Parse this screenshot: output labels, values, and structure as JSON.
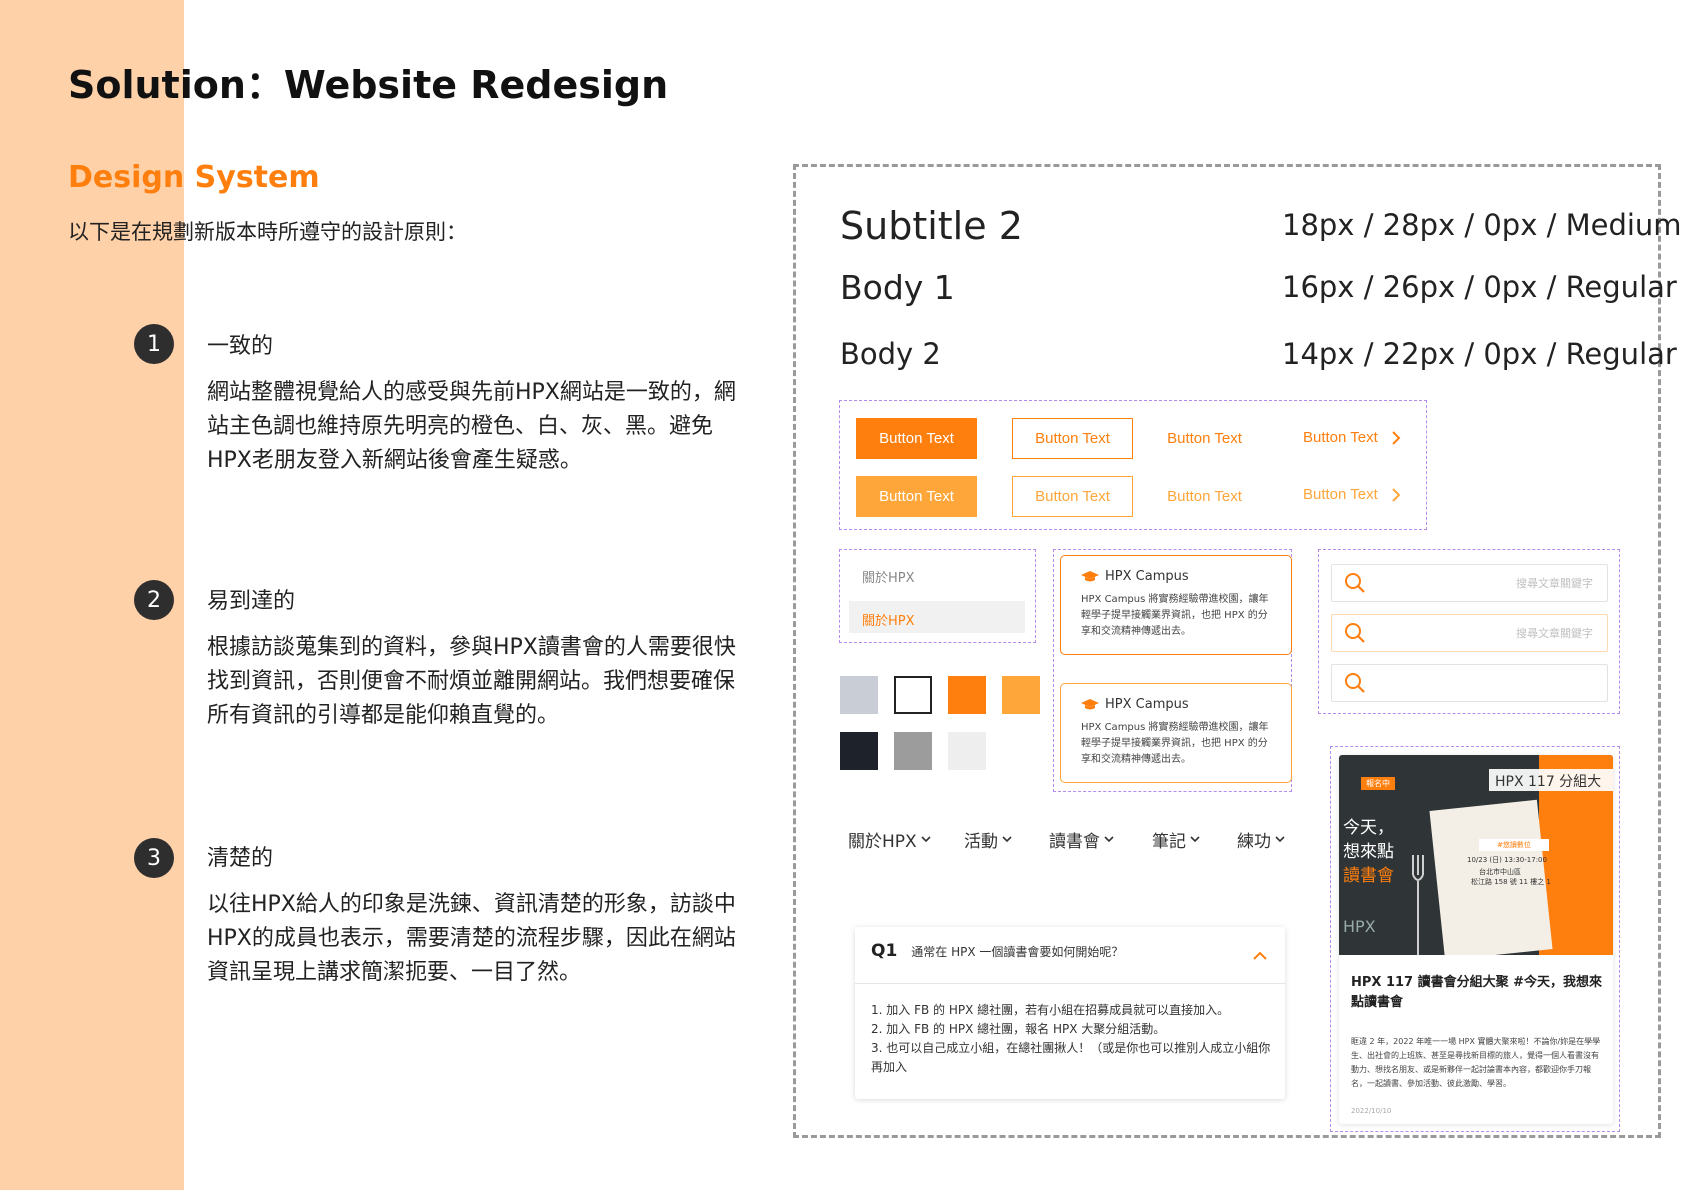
{
  "colors": {
    "sidebar": "#ffd1a8",
    "accent": "#ff7f0e",
    "accent_light": "#ffa63a",
    "dark": "#2e2e2e"
  },
  "page": {
    "title": "Solution：Website Redesign",
    "section_title": "Design System",
    "intro": "以下是在規劃新版本時所遵守的設計原則："
  },
  "principles": [
    {
      "num": "1",
      "title": "一致的",
      "text": "網站整體視覺給人的感受與先前HPX網站是一致的，網站主色調也維持原先明亮的橙色、白、灰、黑。避免HPX老朋友登入新網站後會產生疑惑。"
    },
    {
      "num": "2",
      "title": "易到達的",
      "text": "根據訪談蒐集到的資料，參與HPX讀書會的人需要很快找到資訊，否則便會不耐煩並離開網站。我們想要確保所有資訊的引導都是能仰賴直覺的。"
    },
    {
      "num": "3",
      "title": "清楚的",
      "text": "以往HPX給人的印象是洗鍊、資訊清楚的形象，訪談中HPX的成員也表示，需要清楚的流程步驟，因此在網站資訊呈現上講求簡潔扼要、一目了然。"
    }
  ],
  "typography": [
    {
      "name": "Subtitle 2",
      "spec": "18px / 28px / 0px / Medium"
    },
    {
      "name": "Body 1",
      "spec": "16px / 26px / 0px / Regular"
    },
    {
      "name": "Body 2",
      "spec": "14px / 22px / 0px / Regular"
    }
  ],
  "buttons": {
    "label": "Button Text",
    "arrow_icon": "chevron-right-icon"
  },
  "menu": {
    "items": [
      "關於HPX",
      "關於HPX"
    ]
  },
  "swatches": [
    "#c9ced6",
    "#ffffff",
    "#ff7f0e",
    "#ffa63a",
    "#1e222a",
    "#9c9c9c",
    "#eeeeee"
  ],
  "card": {
    "brand": "HPX Campus",
    "text": "HPX Campus 將實務經驗帶進校園，讓年輕學子提早接觸業界資訊，也把 HPX 的分享和交流精神傳遞出去。",
    "icon": "graduation-cap-icon"
  },
  "search": {
    "placeholder": "搜尋文章關鍵字"
  },
  "nav": {
    "items": [
      "關於HPX",
      "活動",
      "讀書會",
      "筆記",
      "練功"
    ]
  },
  "faq": {
    "q_label": "Q1",
    "question": "通常在 HPX 一個讀書會要如何開始呢？",
    "answers": [
      "1. 加入 FB 的 HPX 總社團，若有小組在招募成員就可以直接加入。",
      "2. 加入 FB 的 HPX 總社團，報名 HPX 大聚分組活動。",
      "3. 也可以自己成立小組，在總社團揪人！（或是你也可以推別人成立小組你再加入"
    ]
  },
  "article": {
    "image": {
      "badge": "報名中",
      "header": "HPX 117 分組大",
      "left_text_1": "今天，",
      "left_text_2": "想來點",
      "left_text_3": "讀書會",
      "tag": "#悠讀數位",
      "date": "10/23 (日) 13:30-17:00",
      "location": "台北市中山區",
      "address": "松江路 158 號 11 樓之 1"
    },
    "title": "HPX 117 讀書會分組大聚 #今天，我想來點讀書會",
    "body": "眶違 2 年，2022 年唯一一場 HPX 實體大聚來啦！不論你/妳是在學學生、出社會的上班族、甚至是尋找新目標的旅人，覺得一個人看書沒有動力、想找名朋友、或是新夥伴一起討論書本內容，都歡迎你手刀報名，一起讀書、參加活動、彼此激勵、學習。",
    "date": "2022/10/10"
  }
}
